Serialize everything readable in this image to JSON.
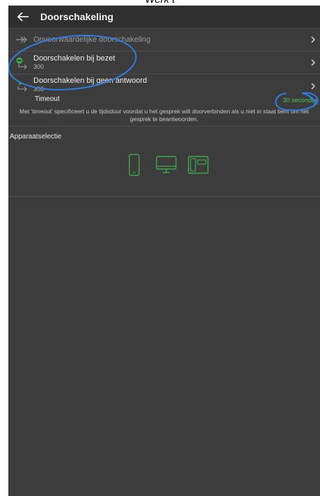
{
  "caption": "Werk t",
  "appbar": {
    "title": "Doorschakeling",
    "back_icon": "arrow-left-icon"
  },
  "rows": [
    {
      "label": "Onvoorwaardelijke doorschakeling",
      "sub": "",
      "icon": "forward-arrows-icon"
    },
    {
      "label": "Doorschakelen bij bezet",
      "sub": "300",
      "icon": "busy-forward-icon"
    },
    {
      "label": "Doorschakelen bij geen antwoord",
      "sub": "300",
      "icon": "noanswer-forward-icon"
    }
  ],
  "timeout": {
    "label": "Timeout",
    "value": "30 seconden"
  },
  "description": "Met 'timeout' specificeert u de tijdsduur voordat u het gesprek wilt doorverbinden als u niet in staat bent om het gesprek te beantwoorden.",
  "device_section": {
    "title": "Apparaatselectie",
    "devices": [
      "mobile-phone-icon",
      "desktop-monitor-icon",
      "desk-phone-icon"
    ]
  },
  "colors": {
    "accent_green": "#4ec259",
    "annotation_blue": "#2f7de0",
    "background": "#3c3c3c"
  }
}
